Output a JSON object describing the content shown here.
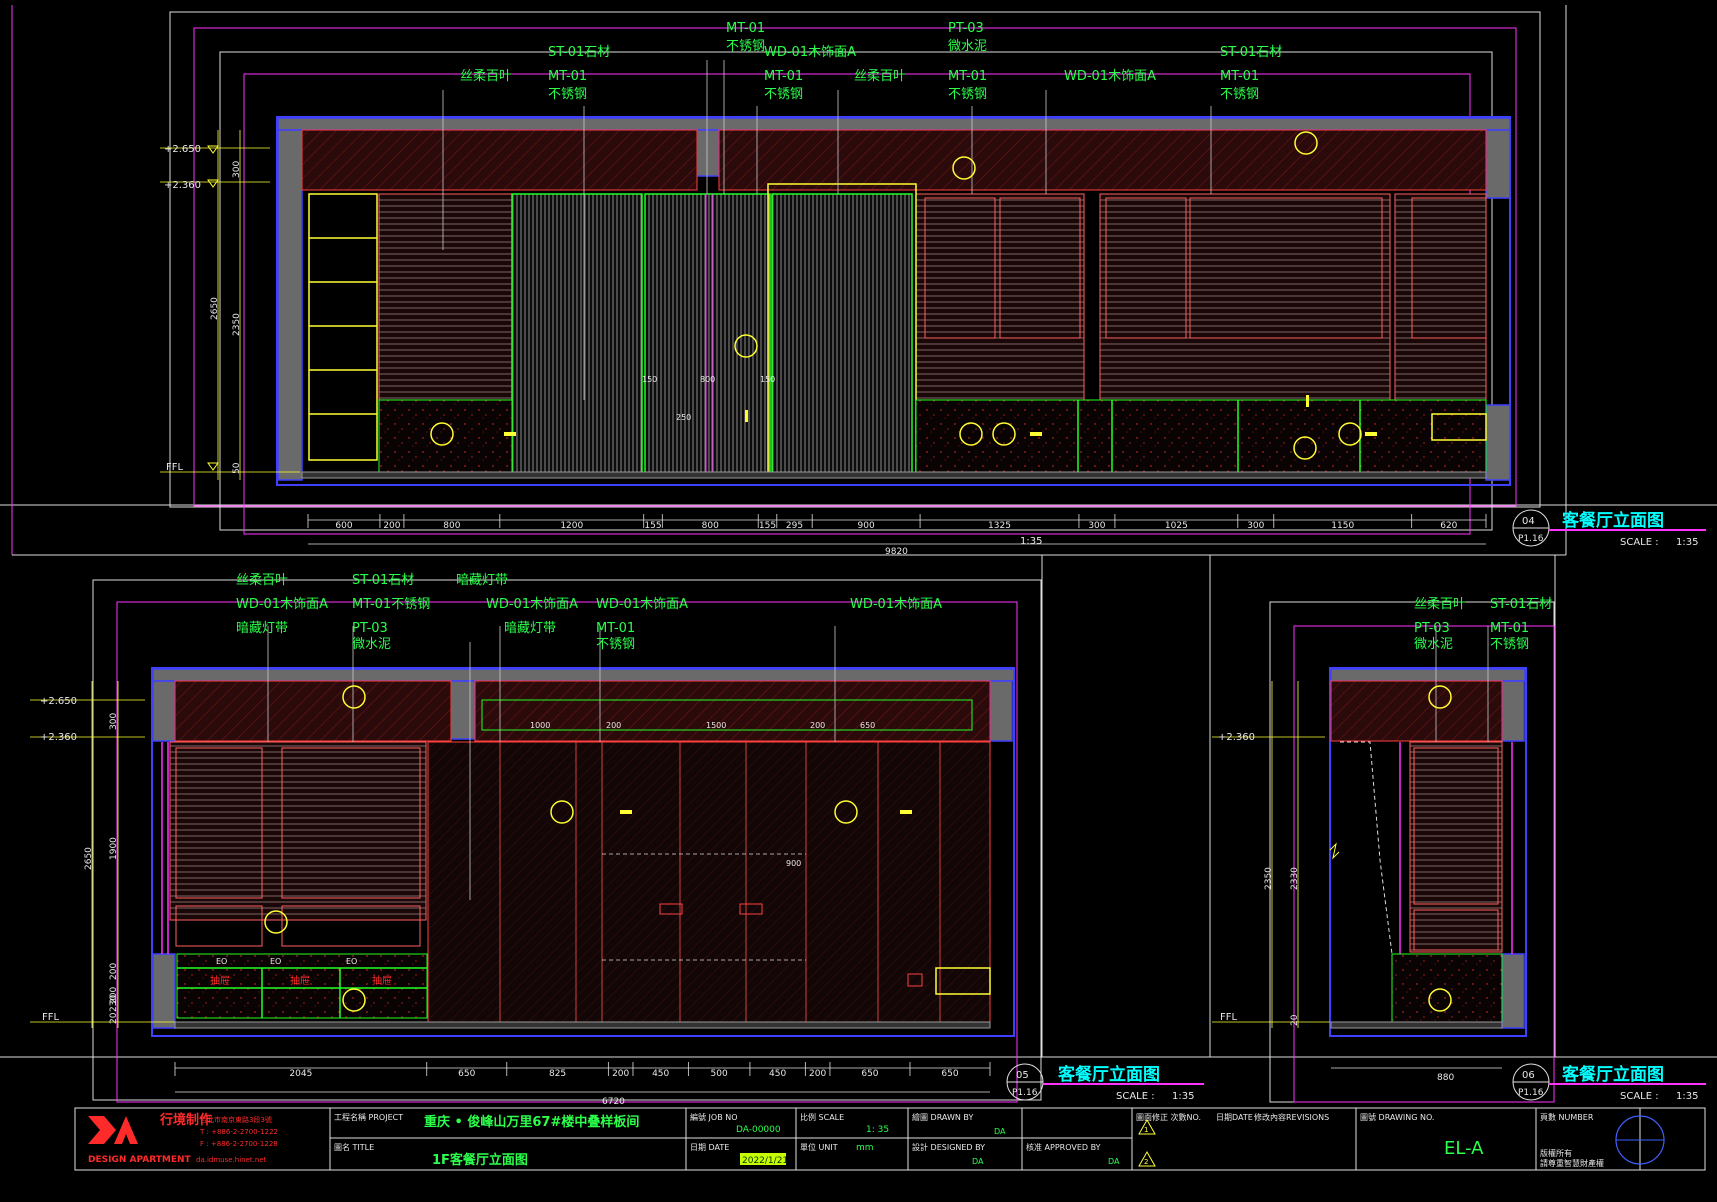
{
  "labels": {
    "e04": {
      "l1": "MT-01",
      "l2": "不锈钢",
      "l3": "PT-03",
      "l4": "微水泥",
      "l5": "ST-01石材",
      "l6": "WD-01木饰面A",
      "l7": "ST-01石材",
      "l8": "丝柔百叶",
      "l9": "MT-01",
      "l10": "不锈钢",
      "l11": "MT-01",
      "l12": "不锈钢",
      "l13": "丝柔百叶",
      "l14": "MT-01",
      "l15": "不锈钢",
      "l16": "WD-01木饰面A",
      "l17": "MT-01",
      "l18": "不锈钢"
    },
    "e05": {
      "l1": "丝柔百叶",
      "l2": "ST-01石材",
      "l3": "暗藏灯带",
      "l4": "WD-01木饰面A",
      "l5": "MT-01不锈钢",
      "l6": "WD-01木饰面A",
      "l7": "WD-01木饰面A",
      "l8": "WD-01木饰面A",
      "l9": "暗藏灯带",
      "l10": "PT-03",
      "l11": "微水泥",
      "l12": "暗藏灯带",
      "l13": "MT-01",
      "l14": "不锈钢"
    },
    "e06": {
      "l1": "丝柔百叶",
      "l2": "ST-01石材",
      "l3": "PT-03",
      "l4": "微水泥",
      "l5": "MT-01",
      "l6": "不锈钢"
    }
  },
  "levels": {
    "l1": "+2.650",
    "l2": "+2.360",
    "ffl": "FFL"
  },
  "vdims_04": [
    "300",
    "2650",
    "2350",
    "50"
  ],
  "vdims_05": [
    "300",
    "2650",
    "1900",
    "200",
    "200",
    "230",
    "20"
  ],
  "vdims_06": [
    "2350",
    "2330",
    "20"
  ],
  "dims_04": [
    "600",
    "200",
    "800",
    "1200",
    "155",
    "800",
    "155",
    "295",
    "900",
    "1325",
    "300",
    "1025",
    "300",
    "1150",
    "620"
  ],
  "total_04": "9820",
  "scale_04": "1:35",
  "dims_05": [
    "2045",
    "650",
    "825",
    "200",
    "450",
    "500",
    "450",
    "200",
    "650",
    "650"
  ],
  "total_05": "6720",
  "dims_06": [
    "880"
  ],
  "inner_05": [
    "1000",
    "200",
    "1500",
    "200",
    "650"
  ],
  "inner_04": [
    "150",
    "800",
    "150",
    "250"
  ],
  "tags_05": [
    "抽屉",
    "抽屉",
    "抽屉"
  ],
  "eo": [
    "EO",
    "EO",
    "EO"
  ],
  "text_900": "900",
  "titles": [
    {
      "num": "04",
      "sheet": "P1.16",
      "name": "客餐厅立面图",
      "scale_label": "SCALE :",
      "scale": "1:35"
    },
    {
      "num": "05",
      "sheet": "P1.16",
      "name": "客餐厅立面图",
      "scale_label": "SCALE :",
      "scale": "1:35"
    },
    {
      "num": "06",
      "sheet": "P1.16",
      "name": "客餐厅立面图",
      "scale_label": "SCALE :",
      "scale": "1:35"
    }
  ],
  "titleblock": {
    "logo_line1": "DESIGN APARTMENT",
    "logo_cn": "行境制作",
    "addr1": "台北市南京東路3段3號",
    "addr2": "T : +886-2-2700-1222",
    "addr3": "F : +886-2-2700-1228",
    "addr4": "da.idmuse.hinet.net",
    "project_label": "工程名稱 PROJECT",
    "project": "重庆 • 俊峰山万里67#楼中叠样板间",
    "title_label": "圖名 TITLE",
    "title": "1F客餐厅立面图",
    "job_label": "編號 JOB NO",
    "job": "DA-00000",
    "scale_label": "比例 SCALE",
    "scale": "1: 35",
    "date_label": "日期 DATE",
    "date": "2022/1/21",
    "unit_label": "單位 UNIT",
    "unit": "mm",
    "drawn_label": "繪圖 DRAWN BY",
    "drawn": "DA",
    "designed_label": "設計 DESIGNED BY",
    "designed": "DA",
    "approved_label": "核准 APPROVED BY",
    "approved": "DA",
    "rev_label": "圖面修正 次數NO.",
    "revdate_label": "日期DATE",
    "revdesc_label": "修改內容REVISIONS",
    "rev1": "1",
    "rev2": "2",
    "drawing_label": "圖號 DRAWING NO.",
    "drawing_no": "EL-A",
    "page_label": "頁數 NUMBER",
    "copyright1": "版權所有",
    "copyright2": "請尊重智慧財產權"
  }
}
